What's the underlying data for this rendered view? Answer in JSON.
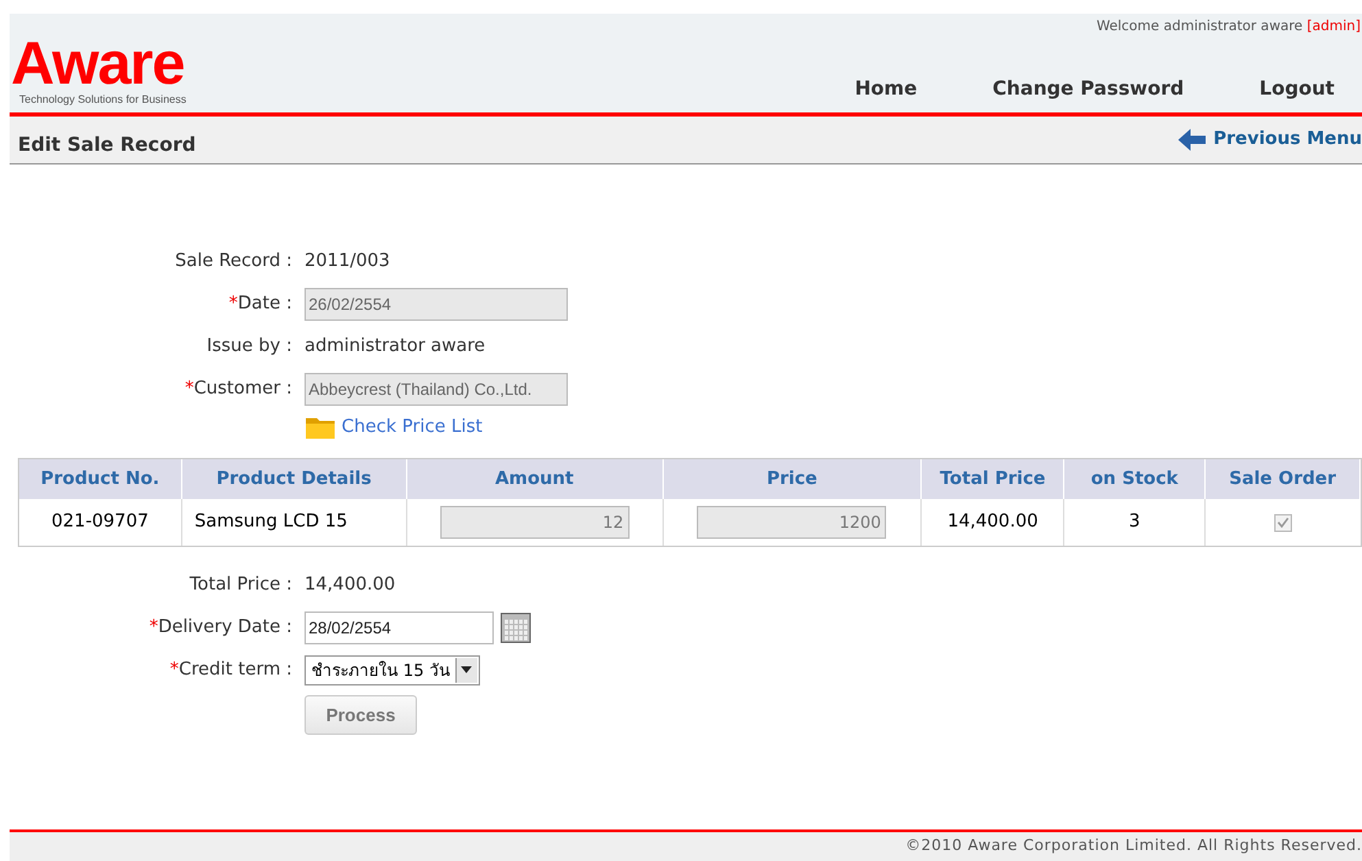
{
  "header": {
    "welcome": "Welcome administrator aware",
    "role": "[admin]",
    "logo": "Aware",
    "tagline": "Technology Solutions for Business",
    "nav": [
      {
        "label": "Home"
      },
      {
        "label": "Change Password"
      },
      {
        "label": "Logout"
      }
    ]
  },
  "subbar": {
    "title": "Edit Sale Record",
    "back_link": "Previous Menu"
  },
  "form": [
    {
      "kind": "text",
      "label": "Sale Record :",
      "value": "2011/003"
    },
    {
      "kind": "field",
      "marker": "*",
      "label": "Date :",
      "value": "26/02/2554",
      "disabled": true
    },
    {
      "kind": "text",
      "label": "Issue by :",
      "value": "administrator aware"
    },
    {
      "kind": "field",
      "marker": "*",
      "label": "Customer :",
      "value": "Abbeycrest (Thailand) Co.,Ltd.",
      "disabled": true
    }
  ],
  "price_list_link": "Check Price List",
  "table": {
    "columns": [
      "Product No.",
      "Product Details",
      "Amount",
      "Price",
      "Total Price",
      "on Stock",
      "Sale Order"
    ],
    "rows": [
      {
        "product_no": "021-09707",
        "details": "Samsung LCD 15",
        "amount": "12",
        "price": "1200",
        "total": "14,400.00",
        "stock": "3",
        "sale_order": {
          "checked": true,
          "disabled": true
        }
      }
    ]
  },
  "summary": [
    {
      "kind": "text",
      "label": "Total Price :",
      "value": "14,400.00"
    },
    {
      "kind": "date",
      "marker": "*",
      "label": "Delivery Date :",
      "value": "28/02/2554",
      "disabled": false
    },
    {
      "kind": "select",
      "marker": "*",
      "label": "Credit term :",
      "value": "ชำระภายใน 15 วัน"
    }
  ],
  "process_button": "Process",
  "footer": "©2010 Aware Corporation Limited. All Rights Reserved."
}
